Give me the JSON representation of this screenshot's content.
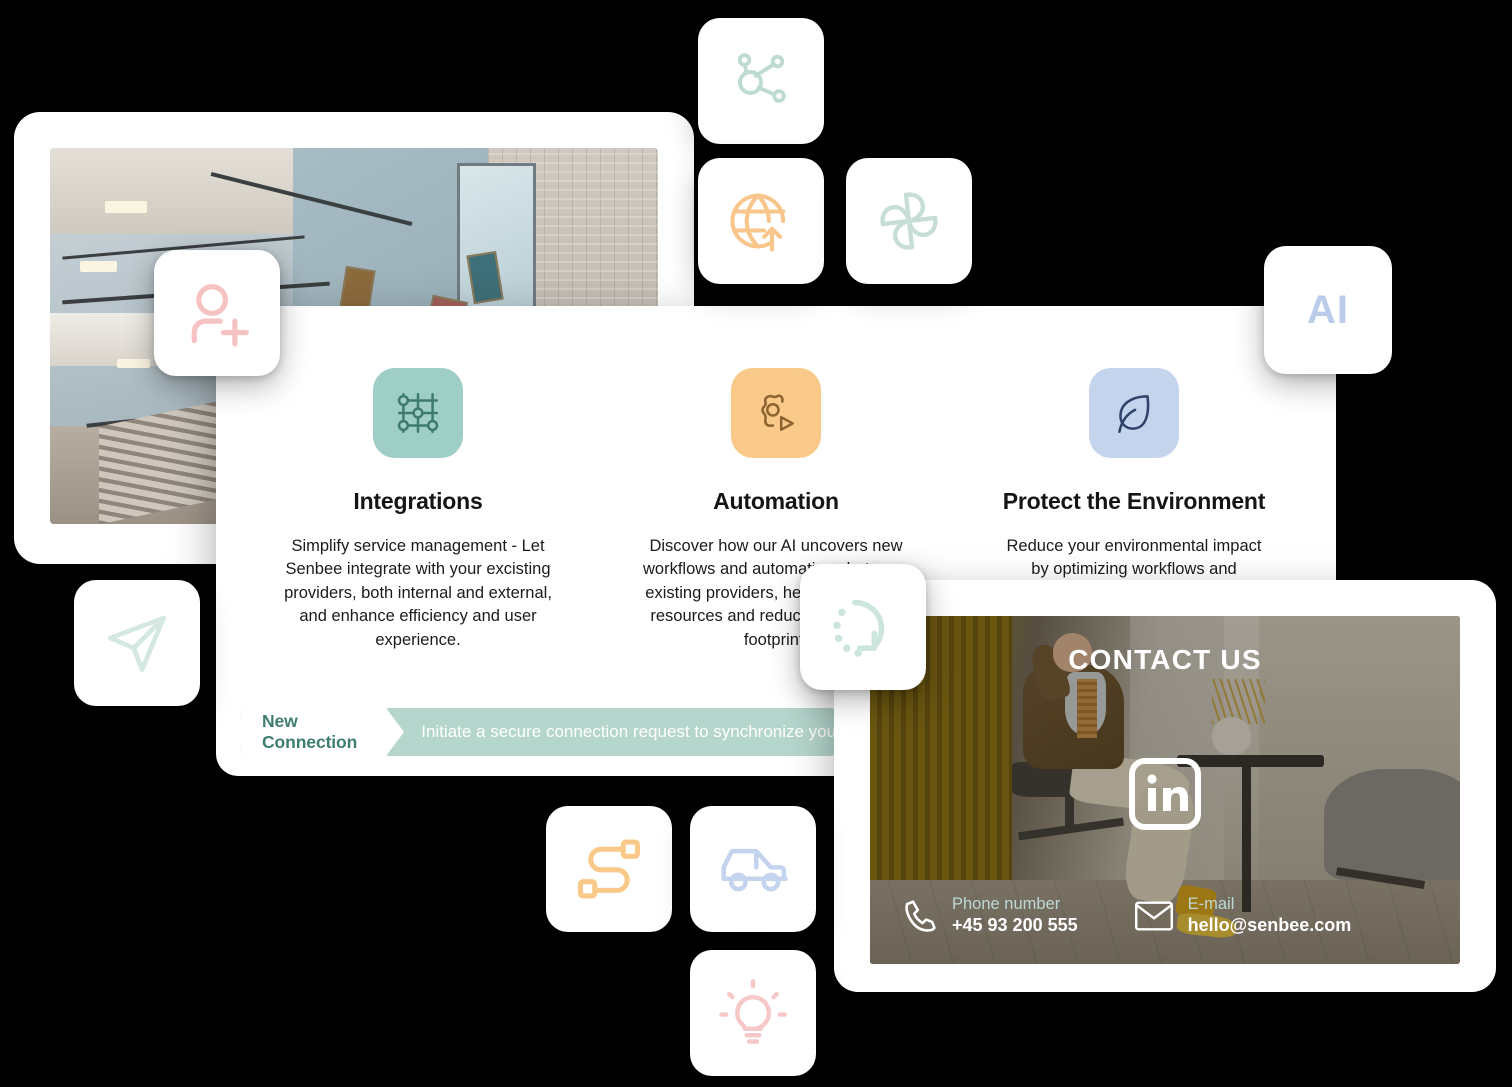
{
  "features": [
    {
      "icon": "integration-grid-icon",
      "icon_bg": "#9FCEC6",
      "icon_stroke": "#3F7A70",
      "title": "Integrations",
      "desc": "Simplify service management - Let Senbee integrate with your excisting providers, both internal and external, and enhance efficiency and user experience."
    },
    {
      "icon": "automation-gear-play-icon",
      "icon_bg": "#F9C98A",
      "icon_stroke": "#8A6330",
      "title": "Automation",
      "desc": "Discover how our AI uncovers new workflows and automations between existing providers, helping you save resources and reduce your carbon footprint."
    },
    {
      "icon": "leaf-icon",
      "icon_bg": "#C4D4EC",
      "icon_stroke": "#2F4268",
      "title": "Protect the Environment",
      "desc": "Reduce your environmental impact by optimizing workflows and automating manual tasks, lowering energy use."
    }
  ],
  "connection": {
    "badge_label": "New Connection",
    "message": "Initiate a secure connection request to synchronize your provider data"
  },
  "contact": {
    "title": "CONTACT US",
    "linkedin_label": "in",
    "phone_label": "Phone number",
    "phone_value": "+45 93 200 555",
    "email_label": "E-mail",
    "email_value": "hello@senbee.com"
  },
  "tiles": [
    {
      "name": "share-network-icon",
      "color": "#BEDBD3"
    },
    {
      "name": "globe-upload-icon",
      "color": "#F8C68A"
    },
    {
      "name": "pinwheel-icon",
      "color": "#C6DED7"
    },
    {
      "name": "ai-label-icon",
      "color": "#B9CDEA",
      "text": "AI"
    },
    {
      "name": "user-plus-icon",
      "color": "#F7C2C3"
    },
    {
      "name": "paper-plane-icon",
      "color": "#D4E8E1"
    },
    {
      "name": "refresh-dotted-icon",
      "color": "#CCE5DE"
    },
    {
      "name": "route-path-icon",
      "color": "#F9C98A"
    },
    {
      "name": "car-icon",
      "color": "#C5D4EE"
    },
    {
      "name": "lightbulb-icon",
      "color": "#F7C8C8"
    }
  ],
  "colors": {
    "accent_teal": "#3F7D71",
    "bar_teal": "#B5D6CD",
    "background": "#000000"
  }
}
